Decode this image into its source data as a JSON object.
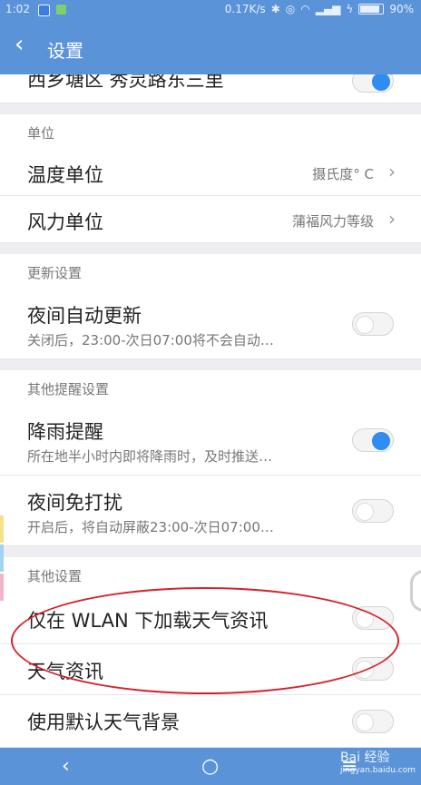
{
  "status_bar": {
    "time": "1:02",
    "speed": "0.17K/s",
    "battery": "90%"
  },
  "app_bar": {
    "back_icon": "chevron-left-icon",
    "title": "设置"
  },
  "location_row": {
    "title": "西乡塘区 秀灵路东三里",
    "toggle_on": true
  },
  "sections": {
    "units": {
      "header": "单位",
      "temperature": {
        "title": "温度单位",
        "value": "摄氏度° C"
      },
      "wind": {
        "title": "风力单位",
        "value": "蒲福风力等级"
      }
    },
    "update": {
      "header": "更新设置",
      "night_update": {
        "title": "夜间自动更新",
        "subtitle": "关闭后，23:00-次日07:00将不会自动…",
        "toggle_on": false
      }
    },
    "alerts": {
      "header": "其他提醒设置",
      "rain": {
        "title": "降雨提醒",
        "subtitle": "所在地半小时内即将降雨时，及时推送…",
        "toggle_on": true
      },
      "dnd": {
        "title": "夜间免打扰",
        "subtitle": "开启后，将自动屏蔽23:00-次日07:00…",
        "toggle_on": false
      }
    },
    "other": {
      "header": "其他设置",
      "wlan_only": {
        "title": "仅在 WLAN 下加载天气资讯",
        "toggle_on": false
      },
      "weather_news": {
        "title": "天气资讯",
        "toggle_on": false
      },
      "default_bg": {
        "title": "使用默认天气背景",
        "toggle_on": false
      }
    }
  },
  "nav_bar": {
    "back": "‹",
    "home": "○",
    "menu": "≡"
  },
  "watermark": {
    "text": "Bai 经验",
    "url": "jingyan.baidu.com"
  },
  "colors": {
    "accent": "#5b93d9",
    "toggle_on": "#2f8cf0",
    "annotation": "#d4232c"
  }
}
